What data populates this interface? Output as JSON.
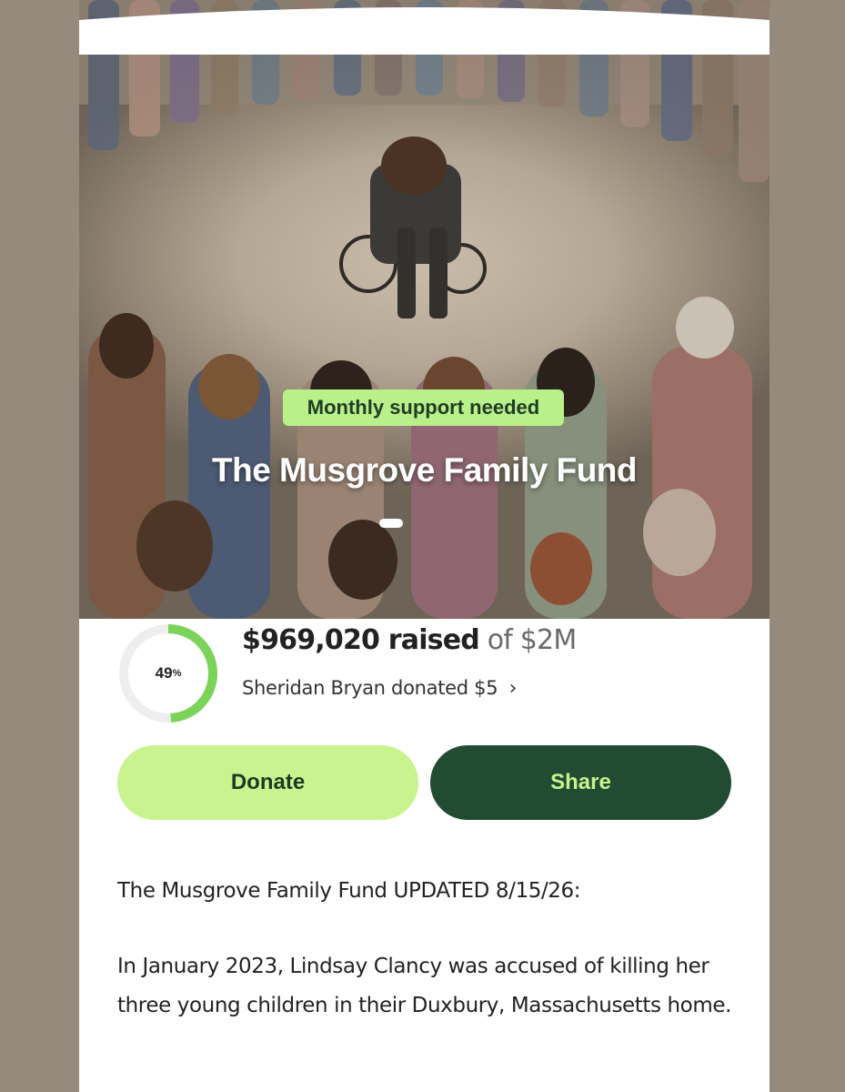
{
  "campaign": {
    "badge": "Monthly support needed",
    "title": "The Musgrove Family Fund",
    "image_alt": "Illustration of a woman in a wheelchair surrounded by a circle of women holding hands"
  },
  "progress": {
    "percent_value": 49,
    "percent_number": "49",
    "percent_sign": "%",
    "raised_amount": "$969,020 raised",
    "goal_text": "of $2M",
    "recent_donation": "Sheridan Bryan donated $5",
    "accent_color": "#7bd35a",
    "track_color": "#eeeeee"
  },
  "actions": {
    "donate_label": "Donate",
    "share_label": "Share"
  },
  "story": {
    "paragraphs": [
      "The Musgrove Family Fund UPDATED 8/15/26:",
      "In January 2023, Lindsay Clancy was accused of killing her three young children in their Duxbury, Massachusetts home."
    ]
  }
}
